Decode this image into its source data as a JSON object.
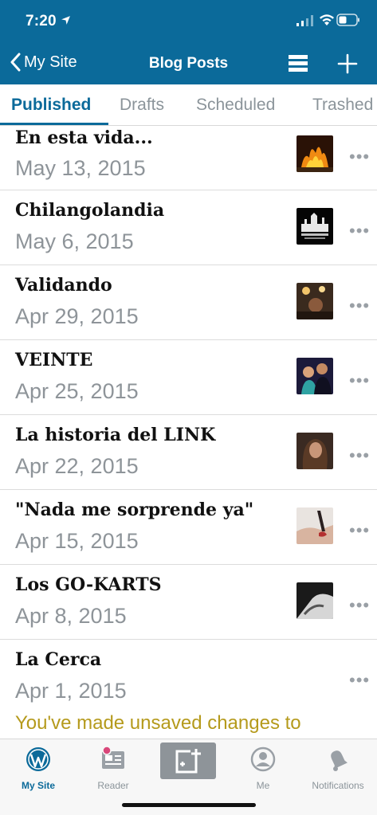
{
  "status": {
    "time": "7:20"
  },
  "nav": {
    "back_label": "My Site",
    "title": "Blog Posts"
  },
  "tabs": [
    {
      "label": "Published",
      "active": true
    },
    {
      "label": "Drafts"
    },
    {
      "label": "Scheduled"
    },
    {
      "label": "Trashed"
    }
  ],
  "posts": [
    {
      "title": "En esta vida...",
      "date": "May 13, 2015",
      "thumb": "fireplace"
    },
    {
      "title": "Chilangolandia",
      "date": "May 6, 2015",
      "thumb": "city-logo"
    },
    {
      "title": "Validando",
      "date": "Apr 29, 2015",
      "thumb": "night-lights"
    },
    {
      "title": "VEINTE",
      "date": "Apr 25, 2015",
      "thumb": "couple-photo"
    },
    {
      "title": "La historia del LINK",
      "date": "Apr 22, 2015",
      "thumb": "portrait-photo"
    },
    {
      "title": "\"Nada me sorprende ya\"",
      "date": "Apr 15, 2015",
      "thumb": "hand-photo"
    },
    {
      "title": "Los GO-KARTS",
      "date": "Apr 8, 2015",
      "thumb": "bw-photo"
    },
    {
      "title": "La Cerca",
      "date": "Apr 1, 2015",
      "thumb": null
    }
  ],
  "more_label": "•••",
  "notice": "You've made unsaved changes to",
  "tabbar": {
    "my_site": "My Site",
    "reader": "Reader",
    "me": "Me",
    "notifications": "Notifications"
  },
  "colors": {
    "brand": "#0b6a9a",
    "muted": "#8e9499",
    "notice": "#b59a1c",
    "badge": "#d9477a"
  }
}
